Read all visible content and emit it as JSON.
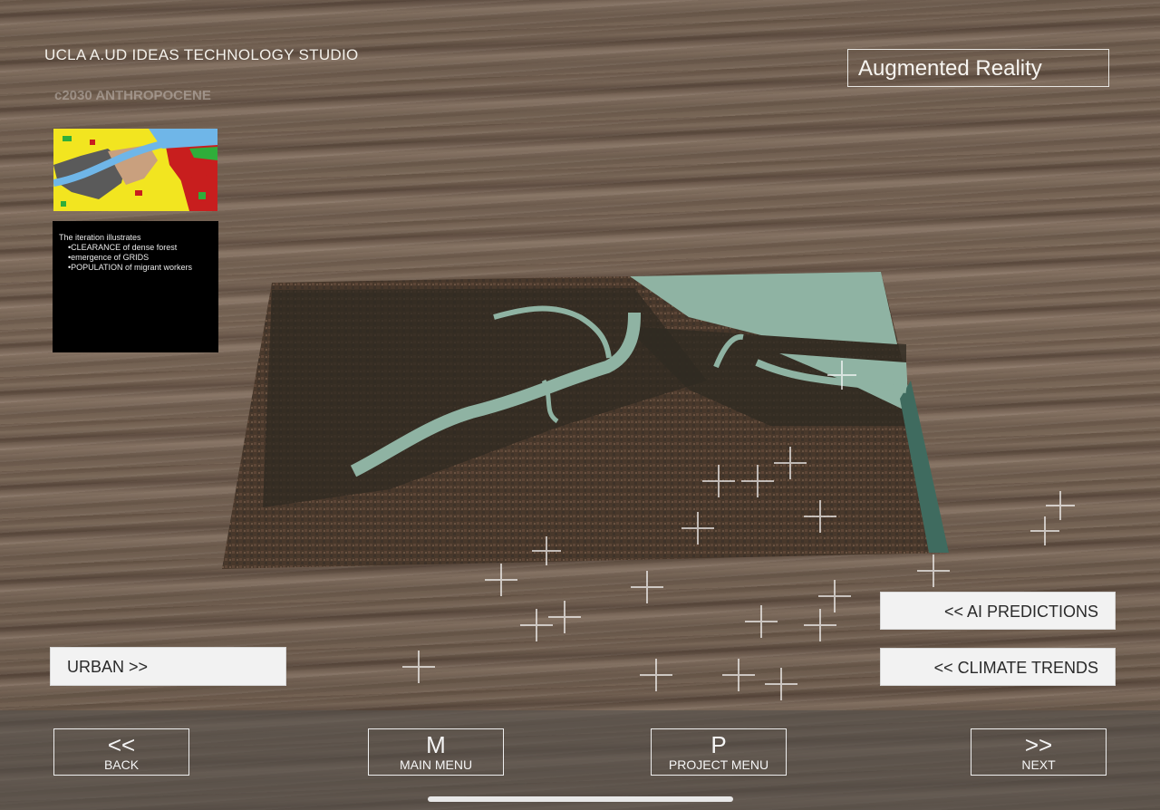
{
  "header": {
    "studio_title": "UCLA A.UD IDEAS TECHNOLOGY STUDIO",
    "mode_label": "Augmented Reality"
  },
  "overlay": {
    "faded_title": "c2030 ANTHROPOCENE"
  },
  "info_panel": {
    "intro": "The iteration illustrates",
    "items": [
      "•CLEARANCE of dense forest",
      "•emergence of GRIDS",
      "•POPULATION of migrant workers"
    ]
  },
  "buttons": {
    "urban": "URBAN  >>",
    "ai_predictions": "<<   AI PREDICTIONS",
    "climate_trends": "<<  CLIMATE TRENDS"
  },
  "nav": {
    "back": {
      "icon": "<<",
      "label": "BACK"
    },
    "main_menu": {
      "icon": "M",
      "label": "MAIN MENU"
    },
    "project_menu": {
      "icon": "P",
      "label": "PROJECT MENU"
    },
    "next": {
      "icon": ">>",
      "label": "NEXT"
    }
  },
  "colors": {
    "thumb_yellow": "#f2e520",
    "thumb_gray": "#5a5a5a",
    "thumb_red": "#c81e1e",
    "thumb_blue": "#6fb6e8",
    "thumb_tan": "#c9a07e",
    "thumb_green": "#2fae3a",
    "river": "#8fb3a3",
    "map_dark": "#2f2a22"
  }
}
